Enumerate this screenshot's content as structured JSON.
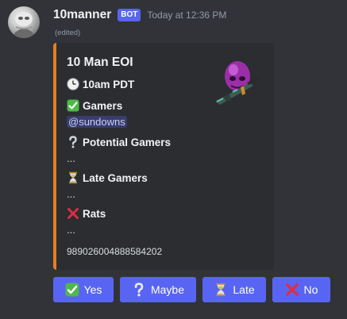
{
  "message": {
    "username": "10manner",
    "badge": "BOT",
    "timestamp": "Today at 12:36 PM",
    "edited": "(edited)"
  },
  "embed": {
    "title": "10 Man EOI",
    "time_label": "10am PDT",
    "accent_color": "#e67e22",
    "fields": [
      {
        "icon": "check-icon",
        "name": "Gamers",
        "value": "@sundowns",
        "is_mention": true
      },
      {
        "icon": "question-icon",
        "name": "Potential Gamers",
        "value": "..."
      },
      {
        "icon": "hourglass-icon",
        "name": "Late Gamers",
        "value": "..."
      },
      {
        "icon": "cross-icon",
        "name": "Rats",
        "value": "..."
      }
    ],
    "footer_id": "989026004888584202"
  },
  "buttons": [
    {
      "icon": "check-icon",
      "label": "Yes"
    },
    {
      "icon": "question-icon",
      "label": "Maybe"
    },
    {
      "icon": "hourglass-icon",
      "label": "Late"
    },
    {
      "icon": "cross-icon",
      "label": "No"
    }
  ],
  "colors": {
    "background": "#313338",
    "embed_bg": "#2b2d31",
    "button": "#5865f2",
    "mention_text": "#c9cdfb"
  }
}
